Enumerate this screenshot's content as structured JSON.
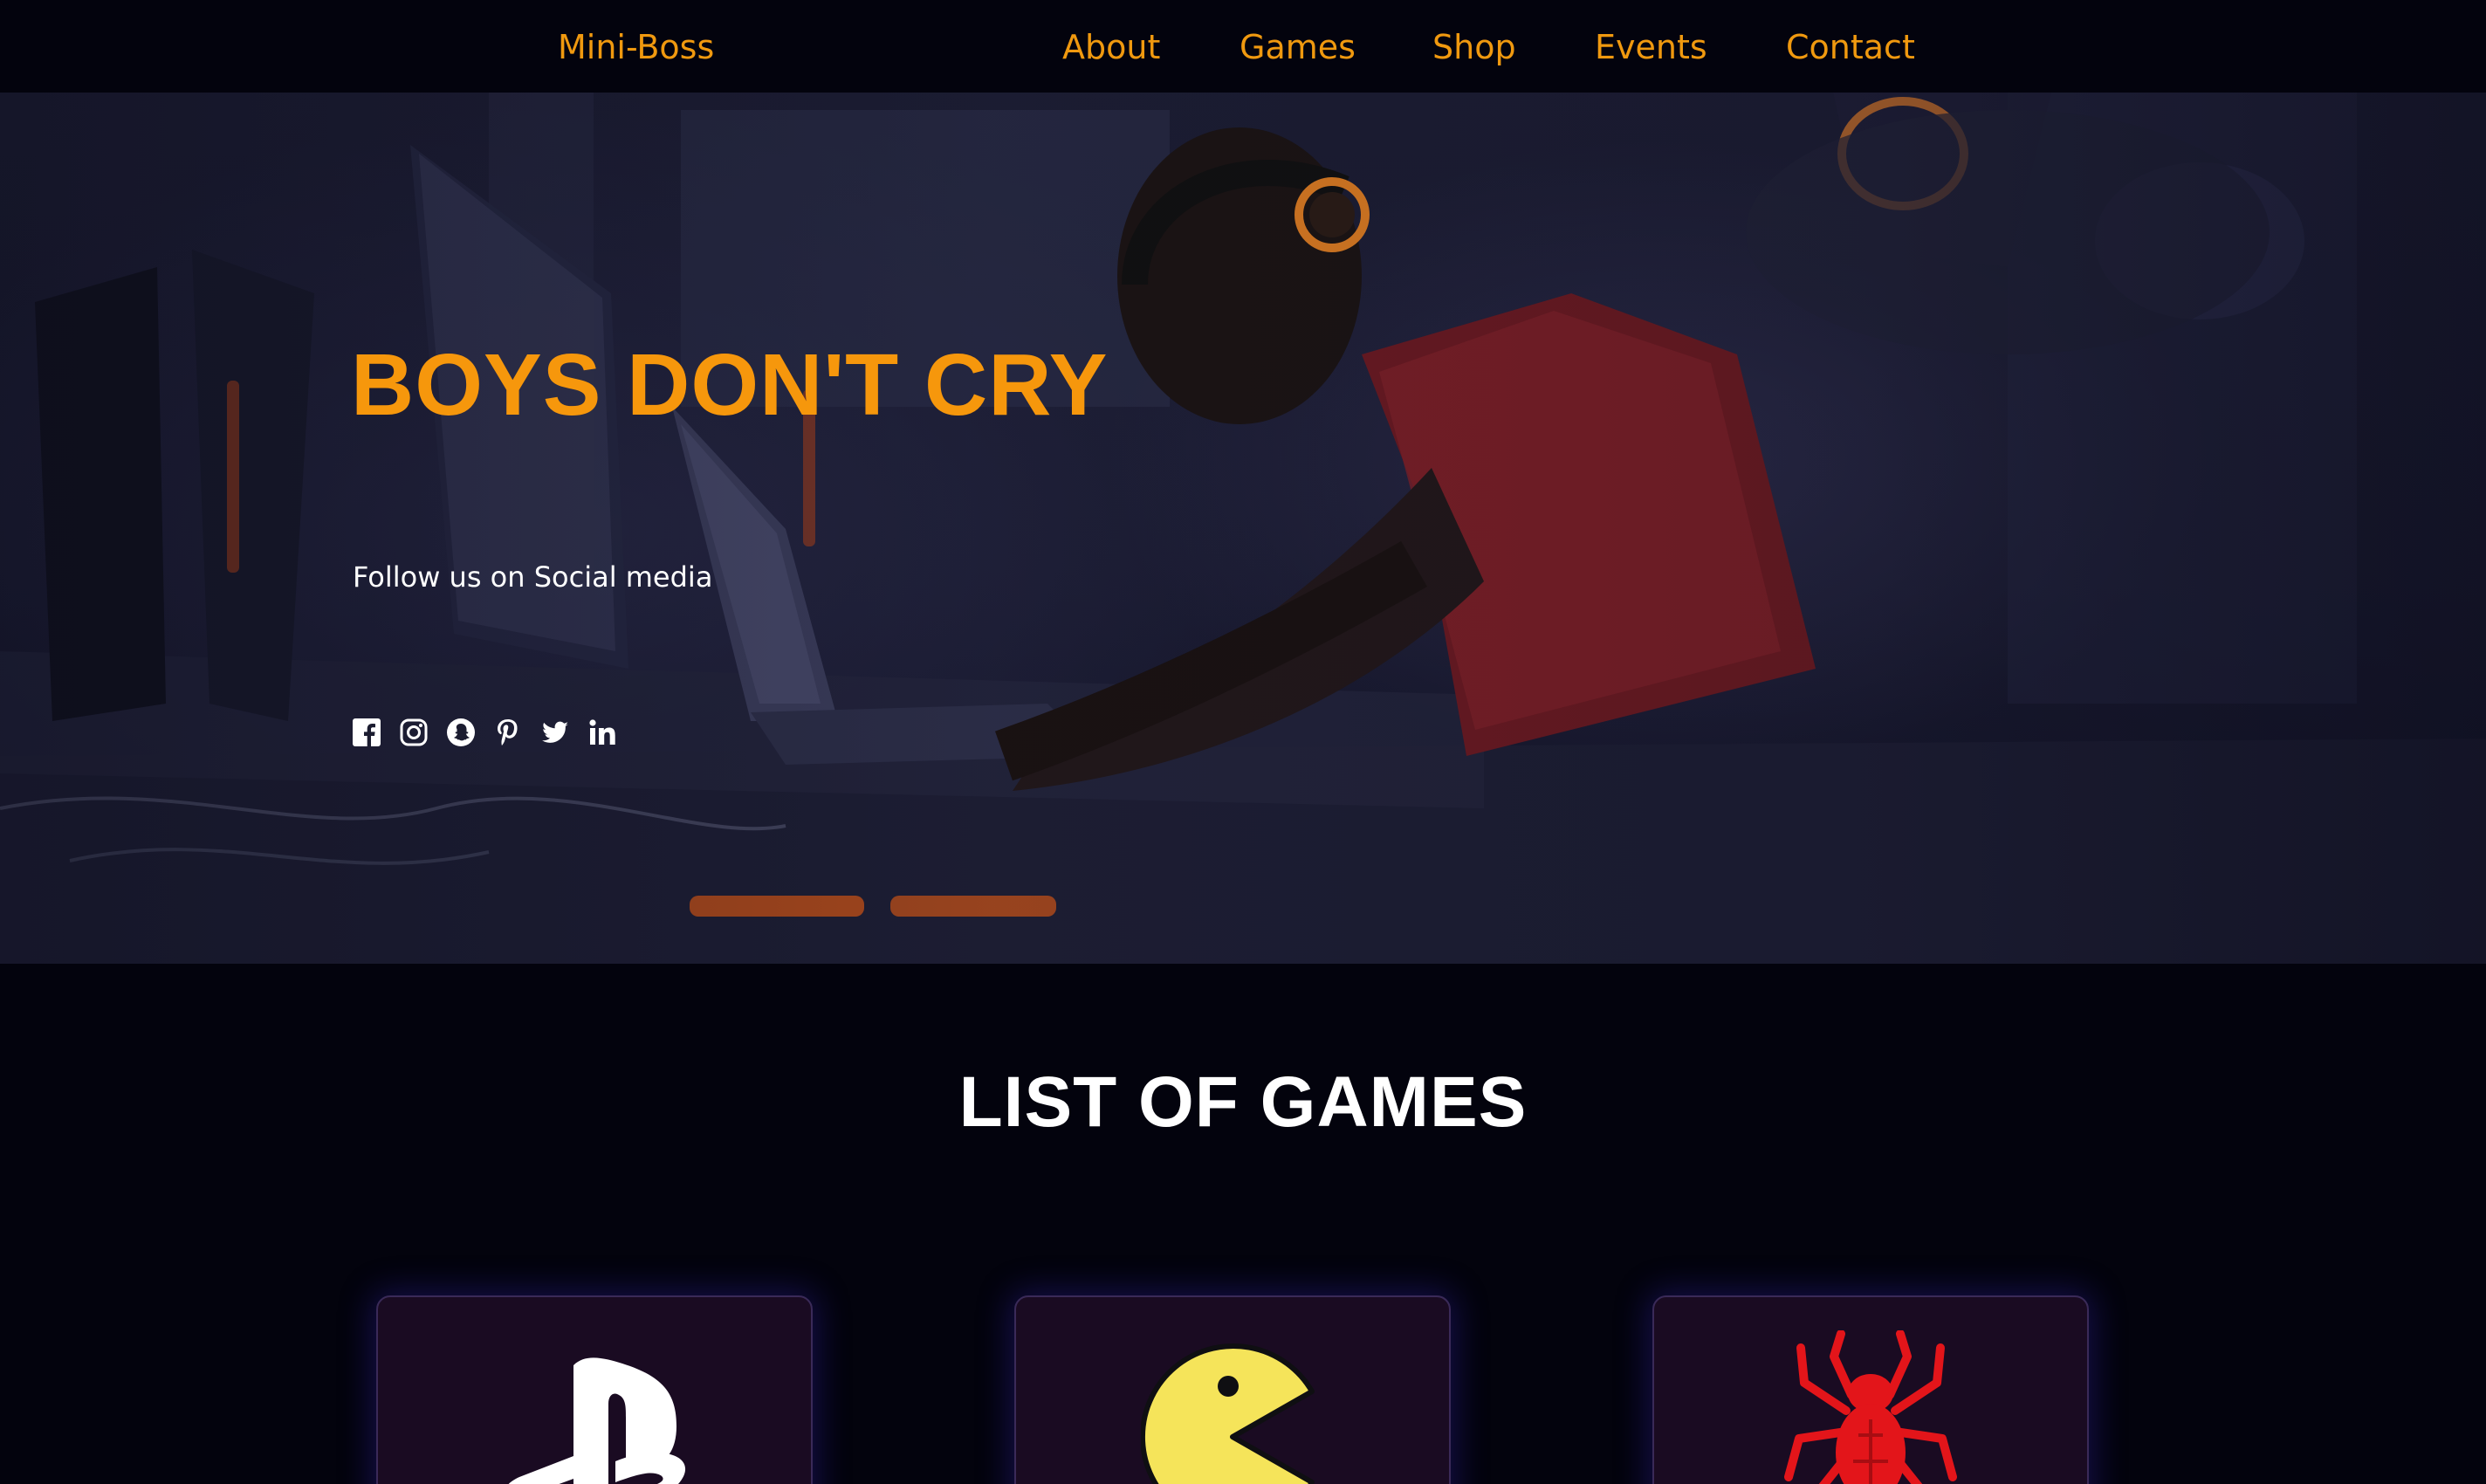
{
  "nav": {
    "brand": "Mini-Boss",
    "links": [
      {
        "label": "About"
      },
      {
        "label": "Games"
      },
      {
        "label": "Shop"
      },
      {
        "label": "Events"
      },
      {
        "label": "Contact"
      }
    ]
  },
  "hero": {
    "title": "BOYS DON'T CRY",
    "follow_text": "Follow us on Social media",
    "socials": [
      "facebook-icon",
      "instagram-icon",
      "snapchat-icon",
      "pinterest-icon",
      "twitter-icon",
      "linkedin-icon"
    ]
  },
  "games_section": {
    "title": "LIST OF GAMES",
    "cards": [
      {
        "icon": "playstation-icon",
        "color": "#ffffff"
      },
      {
        "icon": "pacman-icon",
        "color": "#f5e45a"
      },
      {
        "icon": "spider-icon",
        "color": "#e3151a"
      }
    ]
  },
  "colors": {
    "accent": "#f6970c",
    "background": "#03030d",
    "card_bg": "#1a0b22",
    "card_glow": "#3426b4"
  }
}
